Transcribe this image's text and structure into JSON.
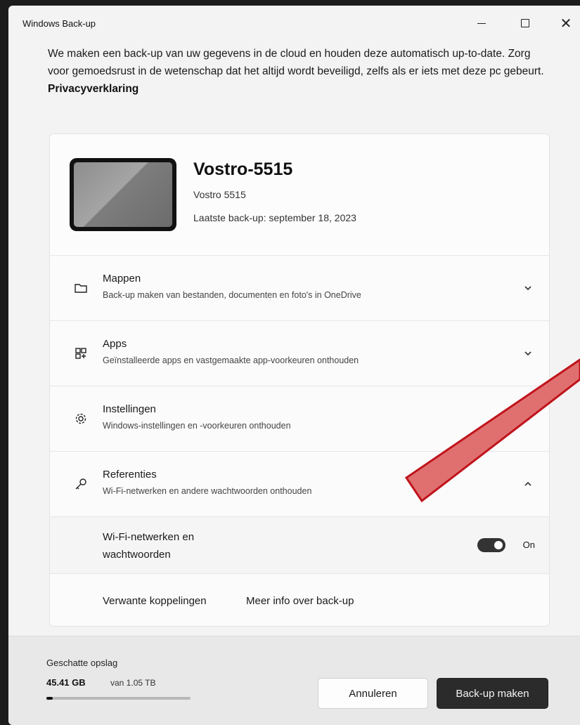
{
  "window": {
    "title": "Windows Back-up"
  },
  "intro": {
    "text": "We maken een back-up van uw gegevens in de cloud en houden deze automatisch up-to-date. Zorg voor gemoedsrust in de wetenschap dat het altijd wordt beveiligd, zelfs als er iets met deze pc gebeurt.",
    "link": "Privacyverklaring"
  },
  "device": {
    "name": "Vostro-5515",
    "model": "Vostro 5515",
    "last_backup": "Laatste back-up: september 18, 2023"
  },
  "sections": [
    {
      "title": "Mappen",
      "subtitle": "Back-up maken van bestanden, documenten en foto's in OneDrive",
      "icon": "folder-icon",
      "expanded": false
    },
    {
      "title": "Apps",
      "subtitle": "Geïnstalleerde apps en vastgemaakte app-voorkeuren onthouden",
      "icon": "apps-icon",
      "expanded": false
    },
    {
      "title": "Instellingen",
      "subtitle": "Windows-instellingen en -voorkeuren onthouden",
      "icon": "gear-icon",
      "expanded": false
    },
    {
      "title": "Referenties",
      "subtitle": "Wi-Fi-netwerken en andere wachtwoorden onthouden",
      "icon": "key-icon",
      "expanded": true
    }
  ],
  "wifi": {
    "label": "Wi-Fi-netwerken en wachtwoorden",
    "toggle_state": "On",
    "on": true
  },
  "related": {
    "label": "Verwante koppelingen",
    "link": "Meer info over back-up"
  },
  "storage": {
    "label": "Geschatte opslag",
    "used": "45.41 GB",
    "total": "van 1.05 TB",
    "fraction": 0.043
  },
  "buttons": {
    "cancel": "Annuleren",
    "backup": "Back-up maken"
  },
  "colors": {
    "annotation_arrow": "#c0141c",
    "annotation_fill": "#e07070"
  }
}
